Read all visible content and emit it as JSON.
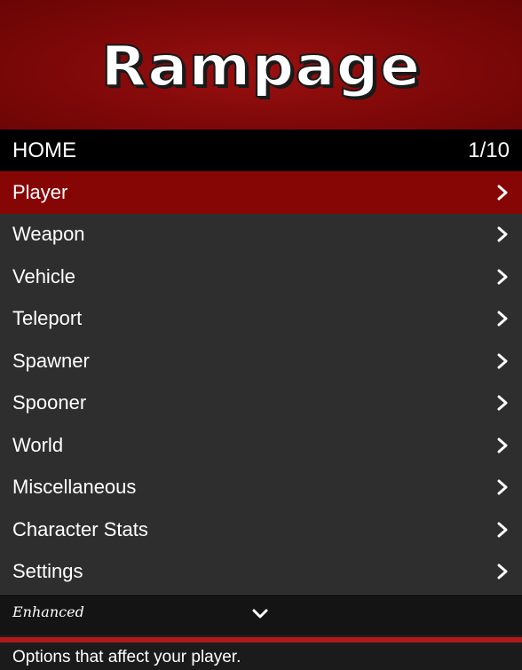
{
  "banner": {
    "title": "Rampage",
    "brand_color": "#860606"
  },
  "header": {
    "title": "HOME",
    "position": "1/10"
  },
  "menu": {
    "selected_index": 0,
    "items": [
      {
        "label": "Player",
        "icon": "chevron-right-icon"
      },
      {
        "label": "Weapon",
        "icon": "chevron-right-icon"
      },
      {
        "label": "Vehicle",
        "icon": "chevron-right-icon"
      },
      {
        "label": "Teleport",
        "icon": "chevron-right-icon"
      },
      {
        "label": "Spawner",
        "icon": "chevron-right-icon"
      },
      {
        "label": "Spooner",
        "icon": "chevron-right-icon"
      },
      {
        "label": "World",
        "icon": "chevron-right-icon"
      },
      {
        "label": "Miscellaneous",
        "icon": "chevron-right-icon"
      },
      {
        "label": "Character Stats",
        "icon": "chevron-right-icon"
      },
      {
        "label": "Settings",
        "icon": "chevron-right-icon"
      }
    ]
  },
  "footer": {
    "edition": "Enhanced",
    "icon": "chevron-down-icon"
  },
  "description": "Options that affect your player."
}
